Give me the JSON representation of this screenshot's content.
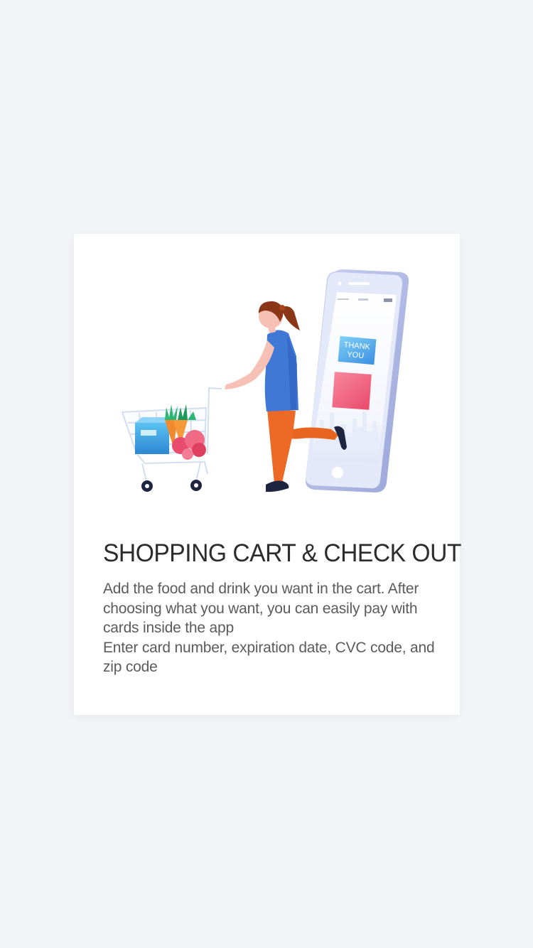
{
  "onboarding": {
    "illustration": {
      "phone_label_line1": "THANK",
      "phone_label_line2": "YOU"
    },
    "title": "SHOPPING CART & CHECK OUT",
    "description_line1": "Add the food and drink you want in the cart. After choosing what you want, you can easily pay with cards inside the app",
    "description_line2": "Enter card number, expiration date, CVC code, and zip code"
  },
  "colors": {
    "background": "#f3f4f6",
    "card": "#ffffff",
    "title": "#2c2c2c",
    "body_text": "#5b5b5b"
  }
}
